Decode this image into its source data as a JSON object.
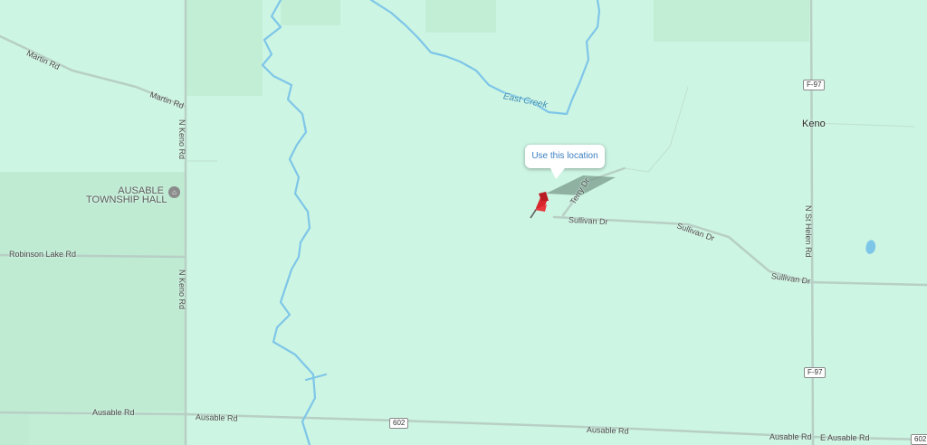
{
  "map": {
    "colors": {
      "land": "#cdf5e3",
      "parcel": "#bfebd3",
      "road": "#b7cfc5",
      "water": "#7ec6e8",
      "pin": "#d8262c"
    },
    "places": {
      "town": "Keno"
    },
    "water": {
      "creek": "East Creek"
    },
    "poi": {
      "line1": "AUSABLE",
      "line2": "TOWNSHIP HALL",
      "icon": "poi-building-icon"
    },
    "roads": {
      "martin_1": "Martin Rd",
      "martin_2": "Martin Rd",
      "n_keno_1": "N Keno Rd",
      "n_keno_2": "N Keno Rd",
      "robinson": "Robinson Lake Rd",
      "ausable_1": "Ausable Rd",
      "ausable_2": "Ausable Rd",
      "ausable_3": "Ausable Rd",
      "ausable_4": "Ausable Rd",
      "e_ausable": "E Ausable Rd",
      "sullivan_1": "Sullivan Dr",
      "sullivan_2": "Sullivan Dr",
      "sullivan_3": "Sullivan Dr",
      "terry": "Terry Dr",
      "n_st_helen": "N St Helen Rd"
    },
    "shields": {
      "f97_top": "F-97",
      "f97_bottom": "F-97",
      "r602_center": "602",
      "r602_right": "602"
    },
    "callout": "Use this location",
    "pin_icon": "red-pushpin-icon"
  }
}
